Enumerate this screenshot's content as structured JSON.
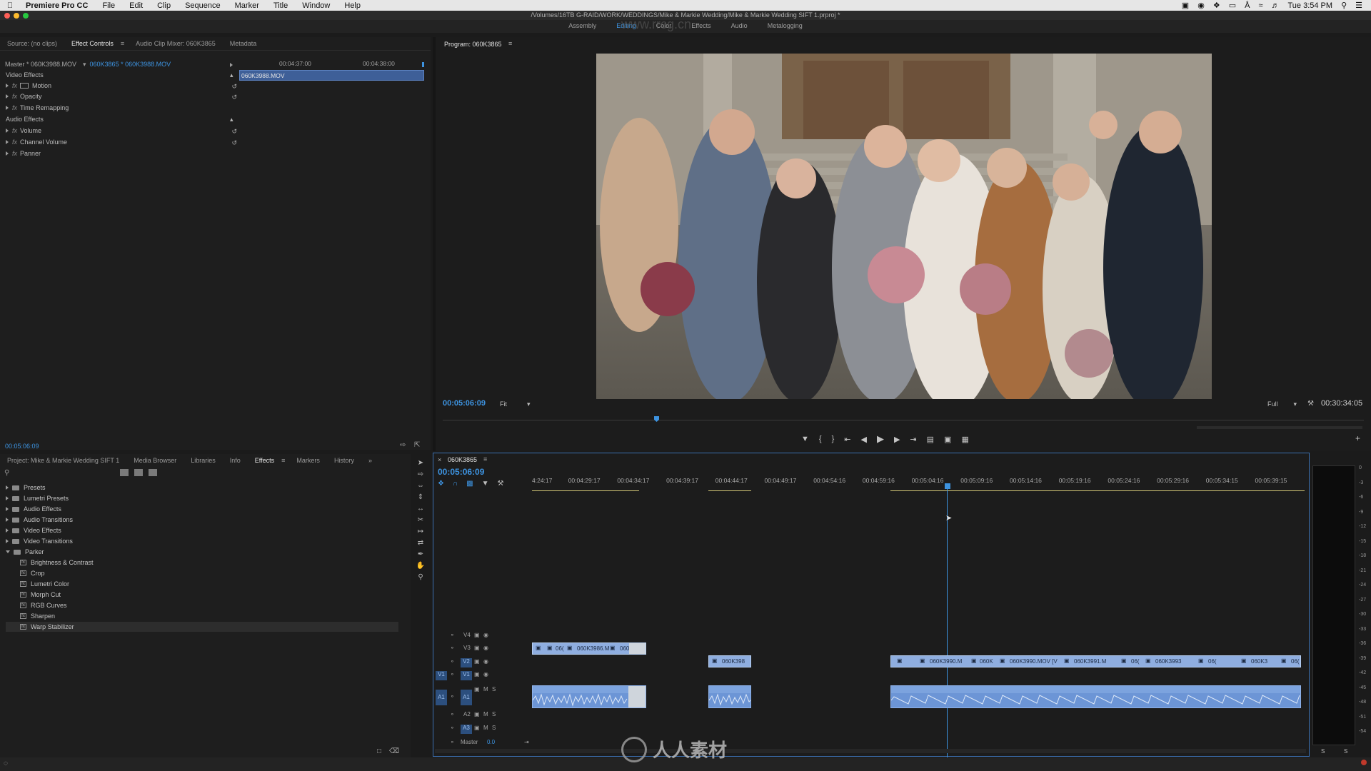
{
  "menubar": {
    "app": "Premiere Pro CC",
    "menus": [
      "File",
      "Edit",
      "Clip",
      "Sequence",
      "Marker",
      "Title",
      "Window",
      "Help"
    ],
    "clock": "Tue 3:54 PM"
  },
  "window": {
    "title": "/Volumes/16TB G-RAID/WORK/WEDDINGS/Mike & Markie Wedding/Mike & Markie Wedding SIFT 1.prproj *"
  },
  "workspaces": [
    "Assembly",
    "Editing",
    "Color",
    "Effects",
    "Audio",
    "Metalogging"
  ],
  "workspace_active": "Editing",
  "source_panel": {
    "tabs": [
      "Source: (no clips)",
      "Effect Controls",
      "Audio Clip Mixer: 060K3865",
      "Metadata"
    ],
    "active_tab": "Effect Controls",
    "master_label": "Master * 060K3988.MOV",
    "sequence_link": "060K3865 * 060K3988.MOV",
    "time_left": "00:04:37:00",
    "time_right": "00:04:38:00",
    "clip_bar_label": "060K3988.MOV",
    "video_effects_header": "Video Effects",
    "audio_effects_header": "Audio Effects",
    "video_effects": [
      "Motion",
      "Opacity",
      "Time Remapping"
    ],
    "audio_effects": [
      "Volume",
      "Channel Volume",
      "Panner"
    ],
    "timecode": "00:05:06:09"
  },
  "program": {
    "title": "Program: 060K3865",
    "timecode": "00:05:06:09",
    "fit": "Fit",
    "quality": "Full",
    "duration": "00:30:34:05",
    "watermark_top": "www.rrcg.cn"
  },
  "project_panel": {
    "tabs": [
      "Project: Mike & Markie Wedding SIFT 1",
      "Media Browser",
      "Libraries",
      "Info",
      "Effects",
      "Markers",
      "History"
    ],
    "active_tab": "Effects",
    "folders": [
      "Presets",
      "Lumetri Presets",
      "Audio Effects",
      "Audio Transitions",
      "Video Effects",
      "Video Transitions",
      "Parker"
    ],
    "parker_items": [
      "Brightness & Contrast",
      "Crop",
      "Lumetri Color",
      "Morph Cut",
      "RGB Curves",
      "Sharpen",
      "Warp Stabilizer"
    ]
  },
  "timeline": {
    "sequence_name": "060K3865",
    "timecode": "00:05:06:09",
    "ruler": [
      "4:24:17",
      "00:04:29:17",
      "00:04:34:17",
      "00:04:39:17",
      "00:04:44:17",
      "00:04:49:17",
      "00:04:54:16",
      "00:04:59:16",
      "00:05:04:16",
      "00:05:09:16",
      "00:05:14:16",
      "00:05:19:16",
      "00:05:24:16",
      "00:05:29:16",
      "00:05:34:15",
      "00:05:39:15"
    ],
    "video_tracks": [
      "V4",
      "V3",
      "V2",
      "V1"
    ],
    "audio_tracks": [
      "A1",
      "A2",
      "A3"
    ],
    "source_patch_v": "V1",
    "source_patch_a": "A1",
    "master_label": "Master",
    "master_value": "0.0",
    "v3_clips": [
      "06(",
      "060K3986.M",
      "060"
    ],
    "v2_clip_a": "060K398",
    "v2_clips_b": [
      "060K3990.M",
      "060K",
      "060K3990.MOV [V",
      "060K3991.M",
      "06(",
      "060K3993",
      "06(",
      "060K3",
      "06("
    ]
  },
  "meters": {
    "scale": [
      "0",
      "-3",
      "-6",
      "-9",
      "-12",
      "-15",
      "-18",
      "-21",
      "-24",
      "-27",
      "-30",
      "-33",
      "-36",
      "-39",
      "-42",
      "-45",
      "-48",
      "-51",
      "-54"
    ],
    "solo": [
      "S",
      "S"
    ]
  },
  "watermark": "人人素材",
  "colors": {
    "accent": "#3d93e0",
    "clip_video": "#8faee0",
    "clip_audio": "#6c95d6",
    "timecode": "#3d93e0"
  }
}
